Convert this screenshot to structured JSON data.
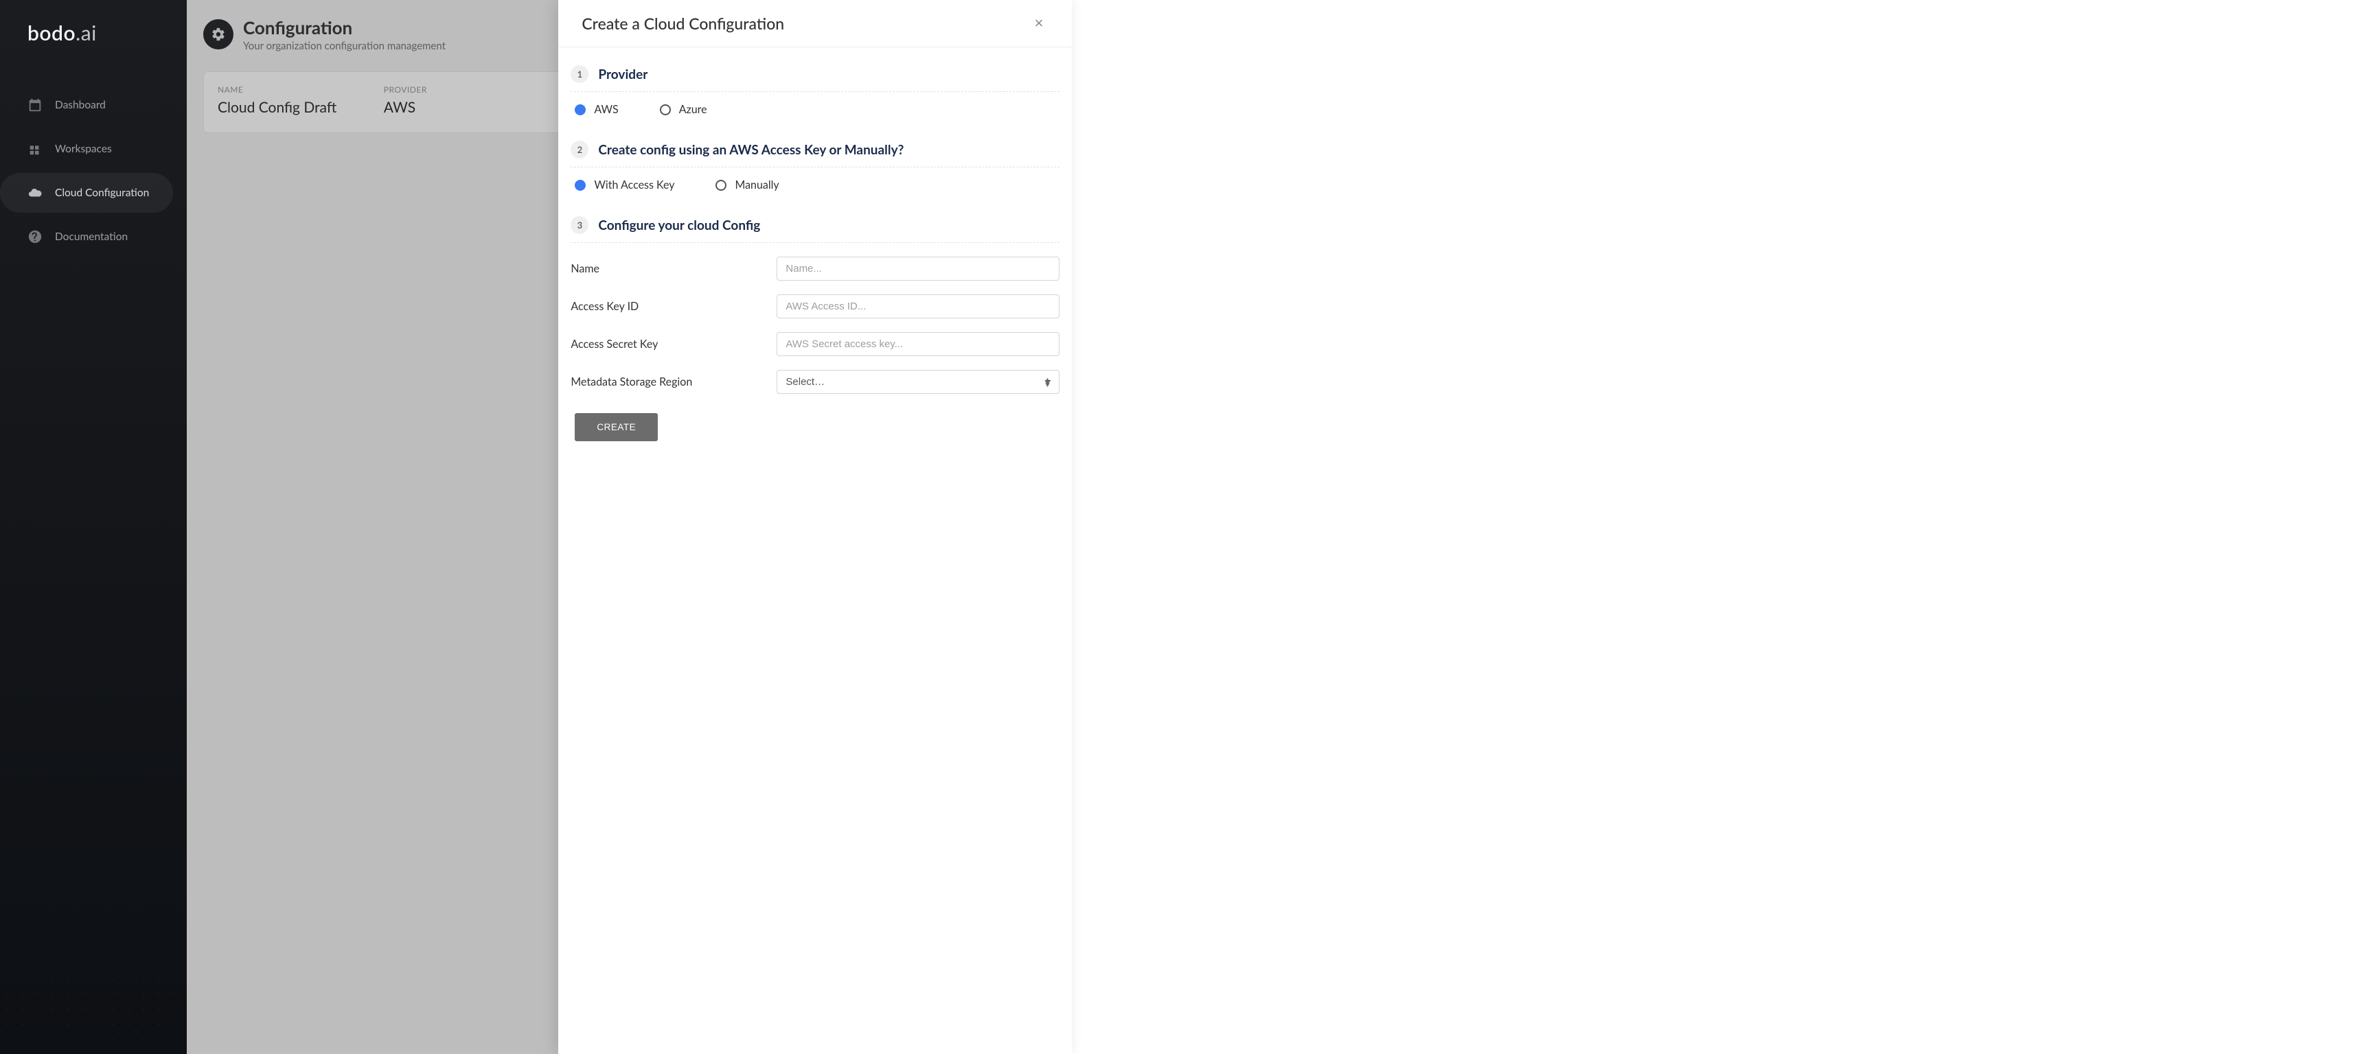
{
  "brand": {
    "name": "bodo",
    "suffix": ".ai"
  },
  "sidebar": {
    "items": [
      {
        "label": "Dashboard"
      },
      {
        "label": "Workspaces"
      },
      {
        "label": "Cloud Configuration"
      },
      {
        "label": "Documentation"
      }
    ]
  },
  "page": {
    "title": "Configuration",
    "subtitle": "Your organization configuration management"
  },
  "config_card": {
    "columns": {
      "name_label": "NAME",
      "provider_label": "PROVIDER"
    },
    "row": {
      "name": "Cloud Config Draft",
      "provider": "AWS"
    }
  },
  "drawer": {
    "title": "Create a Cloud Configuration",
    "steps": {
      "s1": {
        "num": "1",
        "title": "Provider"
      },
      "s2": {
        "num": "2",
        "title": "Create config using an AWS Access Key or Manually?"
      },
      "s3": {
        "num": "3",
        "title": "Configure your cloud Config"
      }
    },
    "provider_options": {
      "aws": "AWS",
      "azure": "Azure",
      "selected": "aws"
    },
    "method_options": {
      "with_key": "With Access Key",
      "manually": "Manually",
      "selected": "with_key"
    },
    "form": {
      "name_label": "Name",
      "name_placeholder": "Name...",
      "access_id_label": "Access Key ID",
      "access_id_placeholder": "AWS Access ID...",
      "secret_label": "Access Secret Key",
      "secret_placeholder": "AWS Secret access key...",
      "region_label": "Metadata Storage Region",
      "region_selected": "Select…"
    },
    "create_button": "CREATE"
  }
}
